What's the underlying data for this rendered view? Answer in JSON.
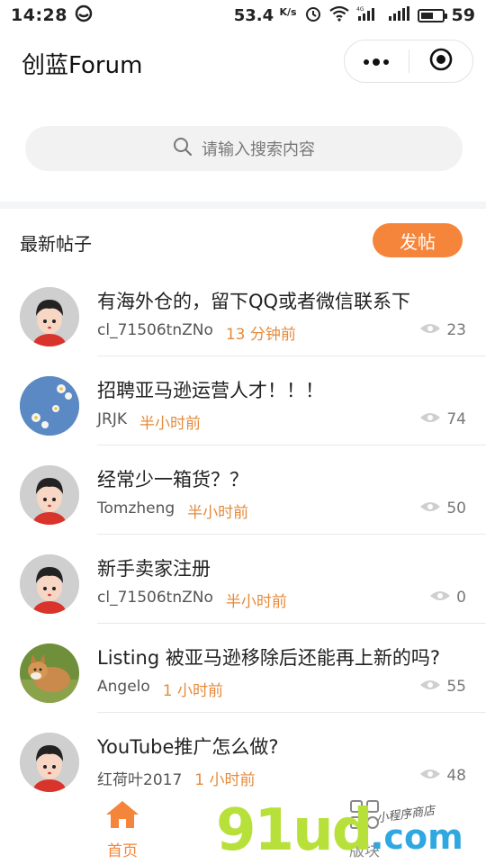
{
  "status_bar": {
    "time": "14:28",
    "speed": "53.4",
    "speed_unit": "K/s",
    "battery": "59"
  },
  "nav": {
    "title": "创蓝Forum"
  },
  "search": {
    "placeholder": "请输入搜索内容"
  },
  "section": {
    "title": "最新帖子",
    "post_button": "发帖"
  },
  "posts": [
    {
      "title": "有海外仓的，留下QQ或者微信联系下",
      "author": "cl_71506tnZNo",
      "time": "13 分钟前",
      "views": "23",
      "avatar": "cartoon-boy"
    },
    {
      "title": "招聘亚马逊运营人才！！！",
      "author": "JRJK",
      "time": "半小时前",
      "views": "74",
      "avatar": "flowers-denim"
    },
    {
      "title": "经常少一箱货？？",
      "author": "Tomzheng",
      "time": "半小时前",
      "views": "50",
      "avatar": "cartoon-boy"
    },
    {
      "title": "新手卖家注册",
      "author": "cl_71506tnZNo",
      "time": "半小时前",
      "views": "0",
      "avatar": "cartoon-boy"
    },
    {
      "title": "Listing 被亚马逊移除后还能再上新的吗?",
      "author": "Angelo",
      "time": "1 小时前",
      "views": "55",
      "avatar": "corgi-dog"
    },
    {
      "title": "YouTube推广怎么做?",
      "author": "红荷叶2017",
      "time": "1 小时前",
      "views": "48",
      "avatar": "cartoon-boy"
    }
  ],
  "tabbar": {
    "home_label": "首页",
    "forum_label": "版块"
  },
  "watermark": {
    "main": "91ud",
    "suffix": ".com",
    "script": "小程序商店"
  },
  "colors": {
    "accent": "#f5853a",
    "time_text": "#e58a3b"
  }
}
